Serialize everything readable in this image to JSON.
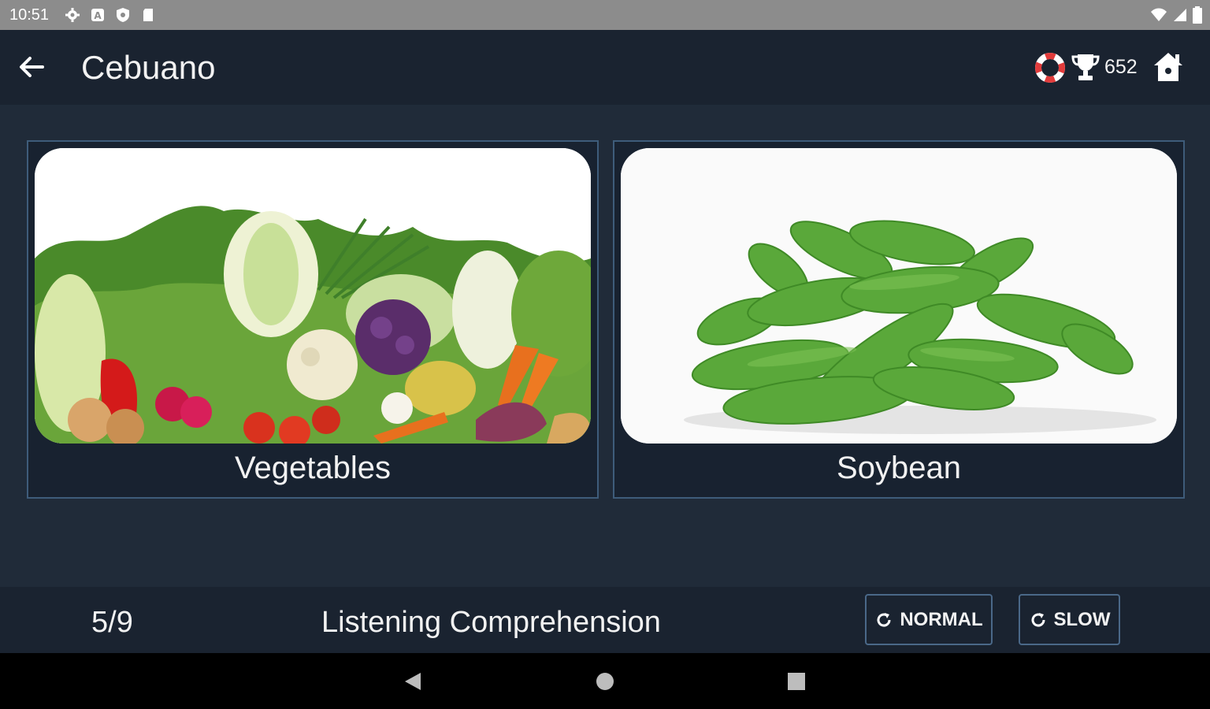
{
  "status_bar": {
    "time": "10:51",
    "icons": [
      "settings-icon",
      "notification-icon",
      "shield-icon",
      "sd-card-icon"
    ],
    "right_icons": [
      "wifi-icon",
      "signal-icon",
      "battery-icon"
    ]
  },
  "app_bar": {
    "title": "Cebuano",
    "score": "652",
    "icons": [
      "back-arrow-icon",
      "lifebuoy-icon",
      "trophy-icon",
      "home-icon"
    ]
  },
  "cards": [
    {
      "label": "Vegetables",
      "image": "vegetables-photo"
    },
    {
      "label": "Soybean",
      "image": "soybean-photo"
    }
  ],
  "bottom_bar": {
    "progress": "5/9",
    "mode": "Listening Comprehension",
    "normal_label": "NORMAL",
    "slow_label": "SLOW"
  },
  "nav_bar": {
    "icons": [
      "back-triangle-icon",
      "home-circle-icon",
      "recents-square-icon"
    ]
  },
  "colors": {
    "app_bar_bg": "#1a2330",
    "main_bg": "#202b39",
    "card_border": "#3e5c7a",
    "text": "#f2f2f2"
  }
}
